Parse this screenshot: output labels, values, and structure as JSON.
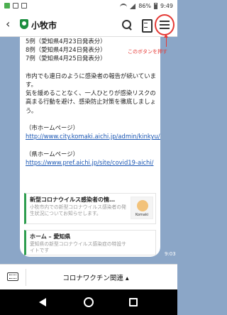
{
  "status": {
    "time": "9:49",
    "battery": "86%"
  },
  "header": {
    "title": "小牧市"
  },
  "annotation": {
    "text": "このボタンを押す"
  },
  "message": {
    "text": "5例（愛知県4月23日発表分）\n8例（愛知県4月24日発表分）\n7例（愛知県4月25日発表分）\n\n市内でも連日のように感染者の報告が続いています。\n気を緩めることなく、一人ひとりが感染リスクの高まる行動を避け、感染防止対策を徹底しましょう。\n\n（市ホームページ）",
    "link1": "http://www.city.komaki.aichi.jp/admin/kinkyu/31726.html",
    "label2": "（県ホームページ）",
    "link2": "https://www.pref.aichi.jp/site/covid19-aichi/"
  },
  "cards": [
    {
      "title": "新型コロナウイルス感染者の情…",
      "desc": "小牧市内での新型コロナウイルス感染者の発生状況についてお知らせします。",
      "thumb_caption": "Komaki"
    },
    {
      "title": "ホーム – 愛知県",
      "desc": "愛知県の新型コロナウイルス感染症の特設サイトです"
    }
  ],
  "timestamp": "9:03",
  "bottom": {
    "label": "コロナワクチン関連 ▴"
  }
}
